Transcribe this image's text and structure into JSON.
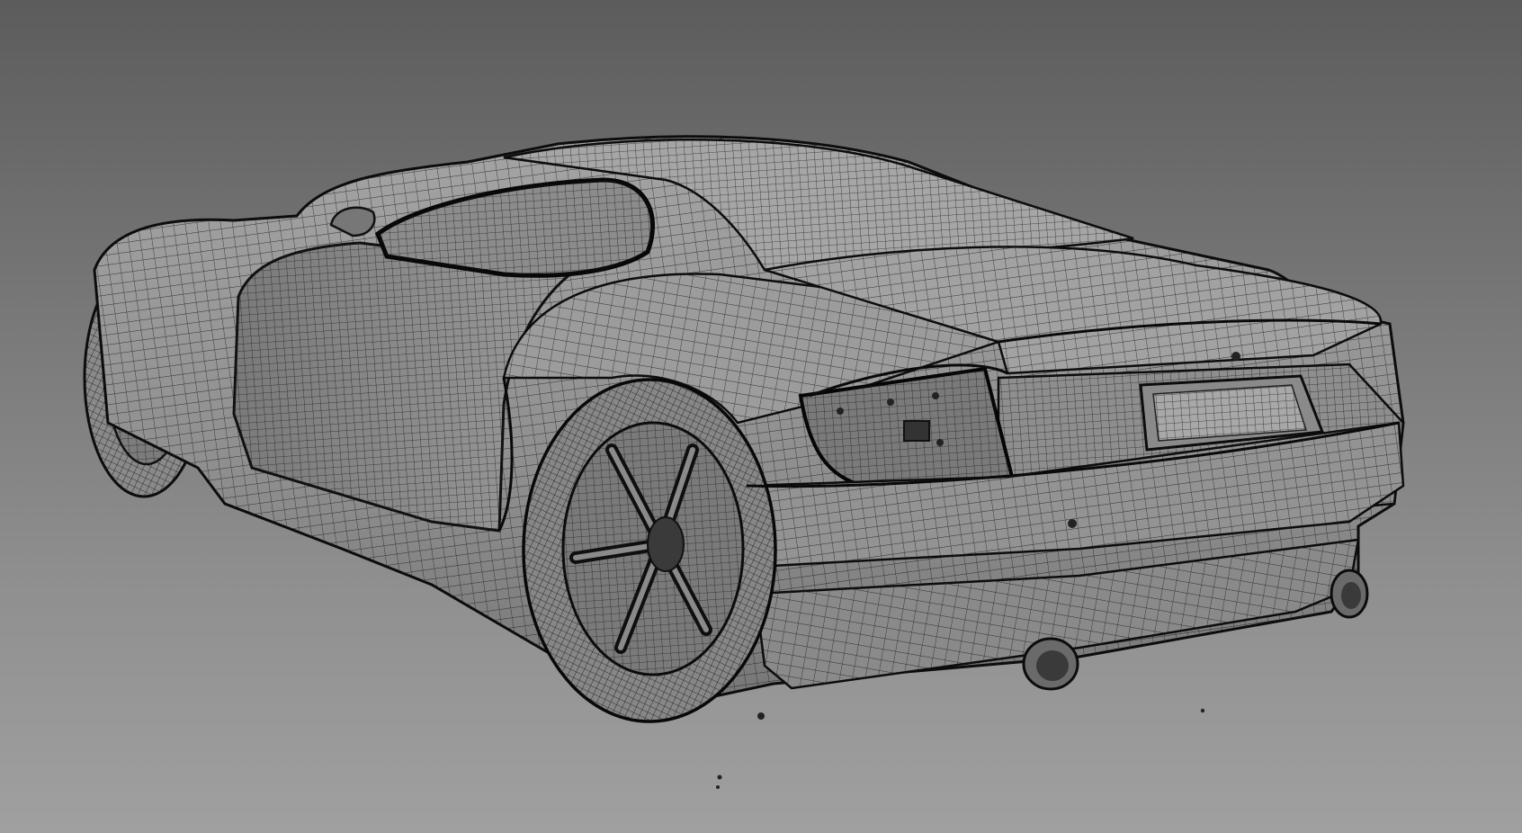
{
  "viewport": {
    "mode": "wireframe-on-shaded",
    "subject": "car-model",
    "colors": {
      "background_top": "#5c5c5c",
      "background_bottom": "#a0a0a0",
      "surface": "#9a9a9a",
      "surface_dark": "#6e6e6e",
      "wire": "#1e1e1e",
      "outline": "#0c0c0c"
    }
  }
}
